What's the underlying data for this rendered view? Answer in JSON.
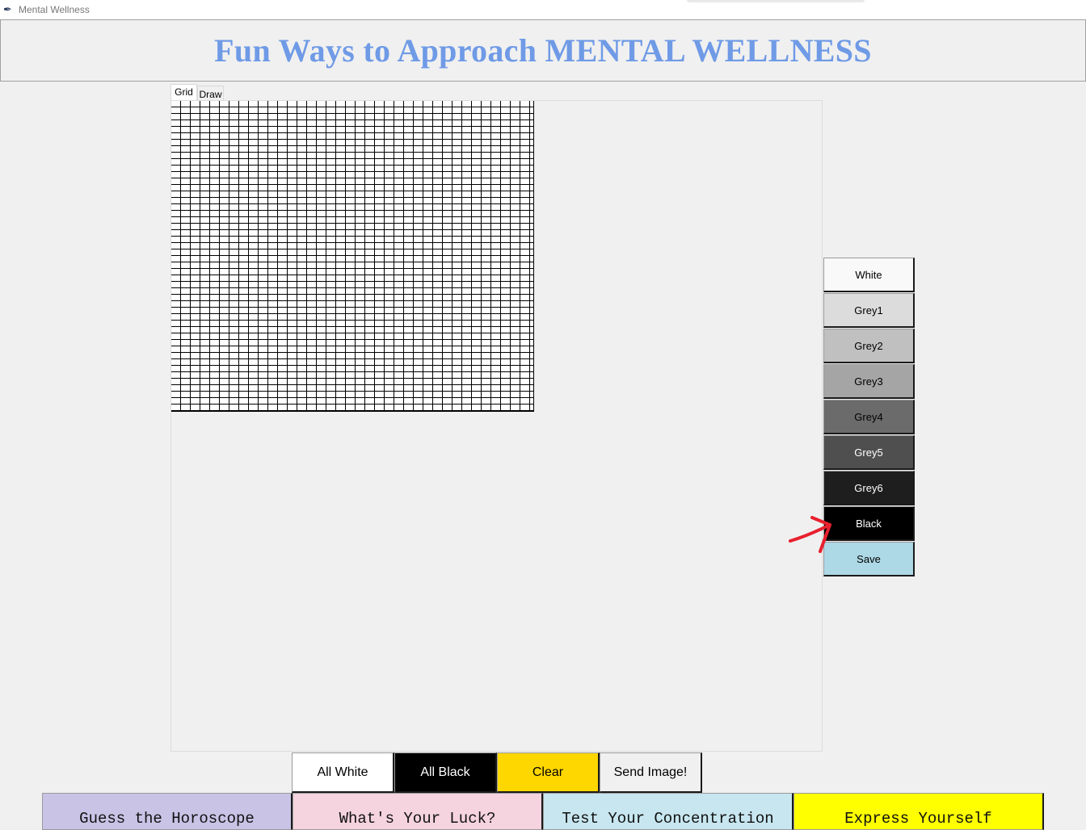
{
  "window": {
    "title": "Mental Wellness",
    "icon": "feather-icon"
  },
  "header": {
    "title": "Fun Ways to Approach MENTAL WELLNESS",
    "color": "#6f9ae6"
  },
  "tabs": [
    {
      "label": "Grid",
      "active": true
    },
    {
      "label": "Draw",
      "active": false
    }
  ],
  "palette": [
    {
      "label": "White",
      "bg": "#f9f9f9",
      "fg": "#000000"
    },
    {
      "label": "Grey1",
      "bg": "#dcdcdc",
      "fg": "#000000"
    },
    {
      "label": "Grey2",
      "bg": "#c0c0c0",
      "fg": "#000000"
    },
    {
      "label": "Grey3",
      "bg": "#a5a5a5",
      "fg": "#000000"
    },
    {
      "label": "Grey4",
      "bg": "#6b6b6b",
      "fg": "#000000"
    },
    {
      "label": "Grey5",
      "bg": "#4f4f4f",
      "fg": "#ffffff"
    },
    {
      "label": "Grey6",
      "bg": "#1e1e1e",
      "fg": "#ffffff"
    },
    {
      "label": "Black",
      "bg": "#000000",
      "fg": "#ffffff"
    },
    {
      "label": "Save",
      "bg": "#add8e6",
      "fg": "#000000"
    }
  ],
  "actions": [
    {
      "label": "All White",
      "bg": "#ffffff",
      "fg": "#000000"
    },
    {
      "label": "All Black",
      "bg": "#000000",
      "fg": "#ffffff"
    },
    {
      "label": "Clear",
      "bg": "#ffd700",
      "fg": "#000000"
    },
    {
      "label": "Send Image!",
      "bg": "#f0f0f0",
      "fg": "#000000"
    }
  ],
  "nav": [
    {
      "label": "Guess the Horoscope",
      "bg": "#c9c3e6"
    },
    {
      "label": "What's Your Luck?",
      "bg": "#f5d3df"
    },
    {
      "label": "Test Your Concentration",
      "bg": "#c7e6f0"
    },
    {
      "label": "Express Yourself",
      "bg": "#ffff00"
    }
  ],
  "annotation": {
    "icon": "red-arrow-icon",
    "color": "#e8202e"
  }
}
